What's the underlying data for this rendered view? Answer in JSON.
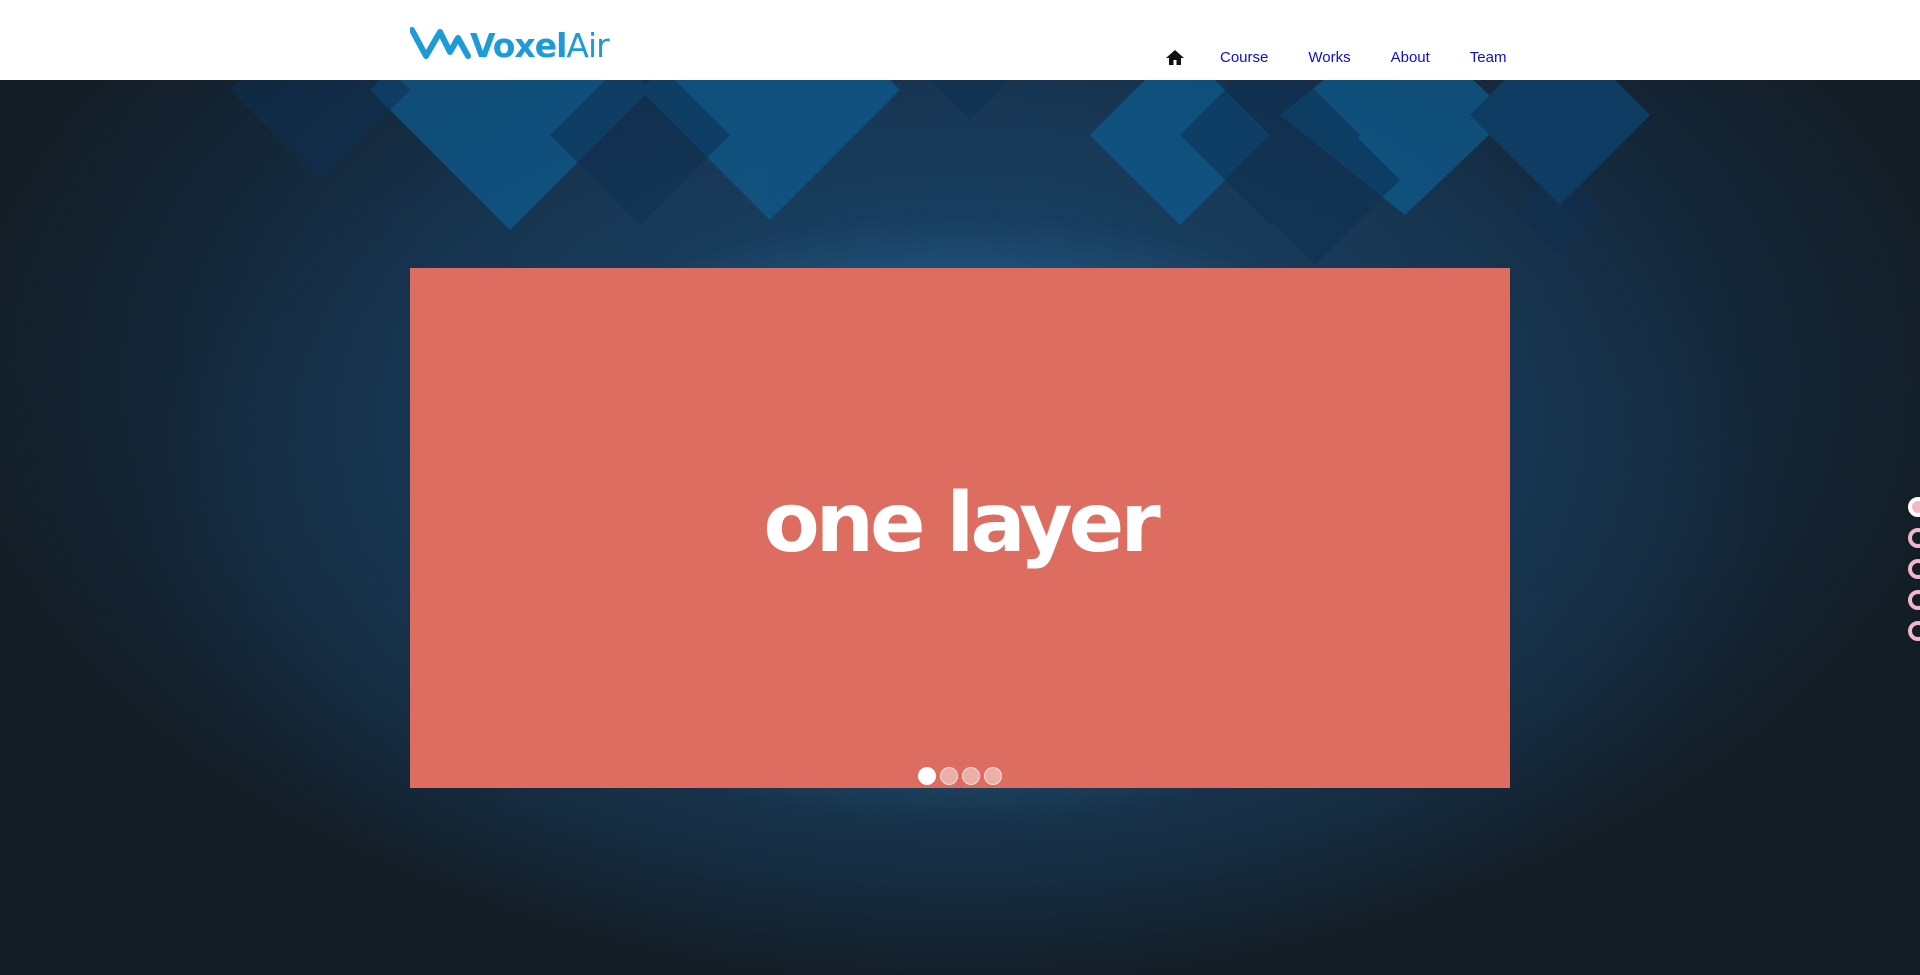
{
  "brand": {
    "name_bold": "Voxel",
    "name_light": "Air"
  },
  "nav": {
    "home_icon": "home-icon",
    "items": [
      {
        "label": "Course"
      },
      {
        "label": "Works"
      },
      {
        "label": "About"
      },
      {
        "label": "Team"
      }
    ]
  },
  "slider": {
    "slide_text": "one layer",
    "background_color": "#dd6d61",
    "dot_count": 4,
    "active_dot": 1
  },
  "side_nav": {
    "dot_count": 5,
    "active_dot": 1,
    "color": "#f2b7c8"
  },
  "colors": {
    "brand": "#1d9bd9",
    "nav_link": "#1010cc"
  }
}
